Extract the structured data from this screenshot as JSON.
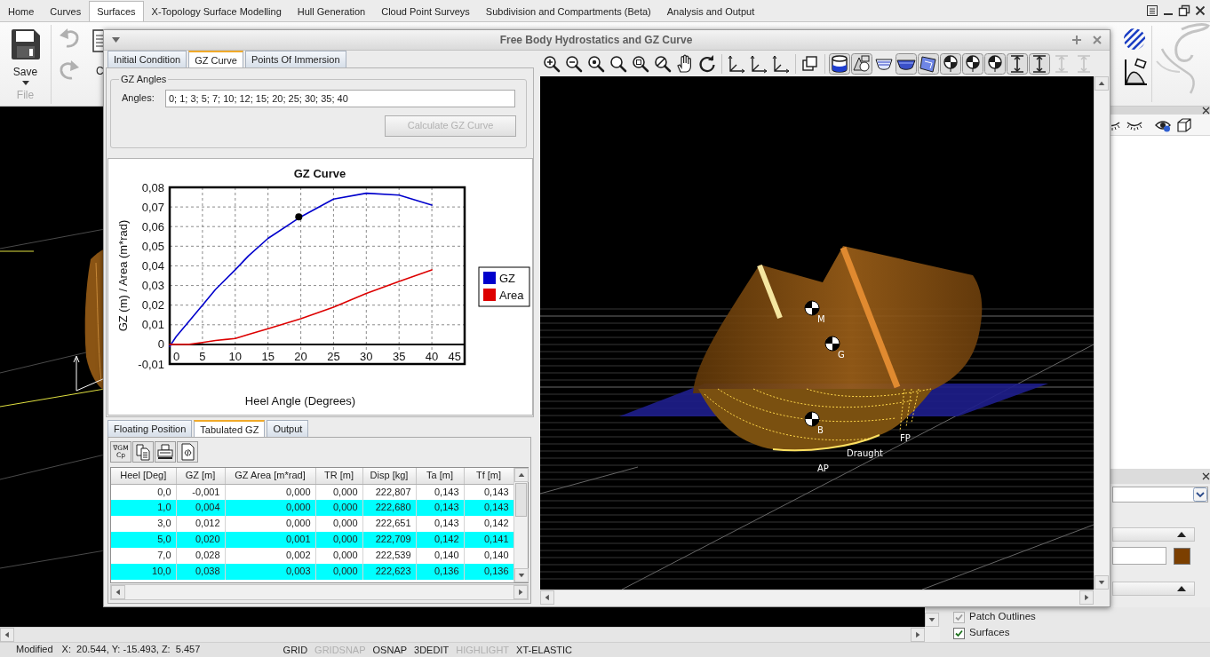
{
  "menu_tabs": [
    {
      "label": "Home",
      "selected": false
    },
    {
      "label": "Curves",
      "selected": false
    },
    {
      "label": "Surfaces",
      "selected": true
    },
    {
      "label": "X-Topology Surface Modelling",
      "selected": false
    },
    {
      "label": "Hull Generation",
      "selected": false
    },
    {
      "label": "Cloud Point Surveys",
      "selected": false
    },
    {
      "label": "Subdivision and Compartments (Beta)",
      "selected": false
    },
    {
      "label": "Analysis and Output",
      "selected": false
    }
  ],
  "ribbon": {
    "save_label": "Save",
    "group_label": "File",
    "history": [
      {
        "kind": "undo",
        "disabled": true
      },
      {
        "kind": "redo",
        "disabled": true
      }
    ],
    "clipped_label": "C"
  },
  "dialog": {
    "title": "Free Body Hydrostatics and GZ Curve",
    "tabs": [
      {
        "label": "Initial Condition",
        "selected": false
      },
      {
        "label": "GZ Curve",
        "selected": true
      },
      {
        "label": "Points Of Immersion",
        "selected": false
      }
    ],
    "gz_angles": {
      "title": "GZ Angles",
      "label": "Angles:",
      "value": "0; 1; 3; 5; 7; 10; 12; 15; 20; 25; 30; 35; 40",
      "button": {
        "label": "Calculate GZ Curve",
        "disabled": true
      }
    },
    "chart_data": {
      "type": "line",
      "title": "GZ Curve",
      "xlabel": "Heel Angle (Degrees)",
      "ylabel": "GZ (m) / Area (m*rad)",
      "x": [
        0,
        1,
        3,
        5,
        7,
        10,
        12,
        15,
        20,
        25,
        30,
        35,
        40
      ],
      "series": [
        {
          "name": "GZ",
          "color": "#0000cc",
          "values": [
            -0.001,
            0.004,
            0.012,
            0.02,
            0.028,
            0.038,
            0.045,
            0.054,
            0.065,
            0.074,
            0.077,
            0.076,
            0.071
          ]
        },
        {
          "name": "Area",
          "color": "#dd0000",
          "values": [
            0,
            0,
            0,
            0.001,
            0.002,
            0.003,
            0.005,
            0.008,
            0.013,
            0.019,
            0.026,
            0.032,
            0.038
          ]
        },
        {
          "type": "scatter",
          "color": "#000000",
          "x": [
            19.7
          ],
          "values": [
            0.065
          ]
        }
      ],
      "xlim": [
        0,
        45
      ],
      "ylim": [
        -0.01,
        0.08
      ],
      "xticks": [
        0,
        5,
        10,
        15,
        20,
        25,
        30,
        35,
        40,
        45
      ],
      "yticks": [
        {
          "value": -0.01,
          "label": "-0,01"
        },
        {
          "value": 0,
          "label": "0"
        },
        {
          "value": 0.01,
          "label": "0,01"
        },
        {
          "value": 0.02,
          "label": "0,02"
        },
        {
          "value": 0.03,
          "label": "0,03"
        },
        {
          "value": 0.04,
          "label": "0,04"
        },
        {
          "value": 0.05,
          "label": "0,05"
        },
        {
          "value": 0.06,
          "label": "0,06"
        },
        {
          "value": 0.07,
          "label": "0,07"
        },
        {
          "value": 0.08,
          "label": "0,08"
        }
      ],
      "ref_lines": [
        {
          "axis": "y",
          "value": 0,
          "color": "#000000",
          "line_style": "solid"
        }
      ],
      "grid": true,
      "legend": "right"
    },
    "result_tabs": [
      {
        "label": "Floating Position",
        "selected": false
      },
      {
        "label": "Tabulated GZ",
        "selected": true
      },
      {
        "label": "Output",
        "selected": false
      }
    ],
    "table_toolbar": [
      {
        "kind": "text",
        "label": "∇GM Cp"
      },
      {
        "kind": "copy"
      },
      {
        "kind": "print"
      },
      {
        "kind": "export"
      }
    ],
    "table": {
      "columns": [
        "Heel [Deg]",
        "GZ [m]",
        "GZ Area [m*rad]",
        "TR [m]",
        "Disp [kg]",
        "Ta [m]",
        "Tf [m]"
      ],
      "rows": [
        {
          "cells": [
            "0,0",
            "-0,001",
            "0,000",
            "0,000",
            "222,807",
            "0,143",
            "0,143"
          ],
          "highlighted": false
        },
        {
          "cells": [
            "1,0",
            "0,004",
            "0,000",
            "0,000",
            "222,680",
            "0,143",
            "0,143"
          ],
          "highlighted": true
        },
        {
          "cells": [
            "3,0",
            "0,012",
            "0,000",
            "0,000",
            "222,651",
            "0,143",
            "0,142"
          ],
          "highlighted": false
        },
        {
          "cells": [
            "5,0",
            "0,020",
            "0,001",
            "0,000",
            "222,709",
            "0,142",
            "0,141"
          ],
          "highlighted": true
        },
        {
          "cells": [
            "7,0",
            "0,028",
            "0,002",
            "0,000",
            "222,539",
            "0,140",
            "0,140"
          ],
          "highlighted": false
        },
        {
          "cells": [
            "10,0",
            "0,038",
            "0,003",
            "0,000",
            "222,623",
            "0,136",
            "0,136"
          ],
          "highlighted": true
        }
      ]
    },
    "view_toolbar": [
      [
        {
          "kind": "zoom-in",
          "pressed": false,
          "disabled": false
        },
        {
          "kind": "zoom-out",
          "pressed": false,
          "disabled": false
        },
        {
          "kind": "zoom-all",
          "pressed": false,
          "disabled": false
        },
        {
          "kind": "zoom",
          "pressed": false,
          "disabled": false
        },
        {
          "kind": "zoom-window",
          "pressed": false,
          "disabled": false
        },
        {
          "kind": "zoom-previous",
          "pressed": false,
          "disabled": false
        },
        {
          "kind": "pan",
          "pressed": false,
          "disabled": false
        },
        {
          "kind": "rotate",
          "pressed": false,
          "disabled": false
        }
      ],
      [
        {
          "kind": "axes",
          "pressed": false,
          "disabled": false
        },
        {
          "kind": "axes",
          "pressed": false,
          "disabled": false
        },
        {
          "kind": "axes",
          "pressed": false,
          "disabled": false
        }
      ],
      [
        {
          "kind": "box",
          "pressed": false,
          "disabled": false
        }
      ],
      [
        {
          "kind": "tank",
          "pressed": true,
          "disabled": false
        },
        {
          "kind": "shapes",
          "pressed": true,
          "disabled": false
        },
        {
          "kind": "section",
          "pressed": false,
          "disabled": false
        },
        {
          "kind": "hull",
          "pressed": true,
          "disabled": false
        },
        {
          "kind": "panel",
          "pressed": true,
          "disabled": false
        },
        {
          "kind": "marker",
          "pressed": true,
          "disabled": false
        },
        {
          "kind": "marker",
          "pressed": true,
          "disabled": false
        },
        {
          "kind": "marker",
          "pressed": true,
          "disabled": false
        },
        {
          "kind": "dimension",
          "pressed": true,
          "disabled": false
        },
        {
          "kind": "dimension",
          "pressed": true,
          "disabled": false
        },
        {
          "kind": "dimension",
          "pressed": false,
          "disabled": true
        },
        {
          "kind": "dimension",
          "pressed": false,
          "disabled": true
        }
      ]
    ],
    "view_3d": {
      "markers": [
        {
          "label": "M"
        },
        {
          "label": "G"
        },
        {
          "label": "B"
        }
      ],
      "labels": [
        "FP",
        "Draught",
        "AP"
      ]
    }
  },
  "side_panel": {
    "surface_swatch": {
      "color": "#7b3f00"
    },
    "layers": [
      {
        "label": "Patch Outlines",
        "checked": true,
        "disabled": true
      },
      {
        "label": "Surfaces",
        "checked": true,
        "disabled": false
      }
    ]
  },
  "status_bar": {
    "state": "Modified",
    "coordinates": "X:  20.544, Y: -15.493, Z:  5.457",
    "toggles": [
      {
        "label": "GRID",
        "on": true
      },
      {
        "label": "GRIDSNAP",
        "on": false
      },
      {
        "label": "OSNAP",
        "on": true
      },
      {
        "label": "3DEDIT",
        "on": true
      },
      {
        "label": "HIGHLIGHT",
        "on": false
      },
      {
        "label": "XT-ELASTIC",
        "on": true
      }
    ]
  }
}
